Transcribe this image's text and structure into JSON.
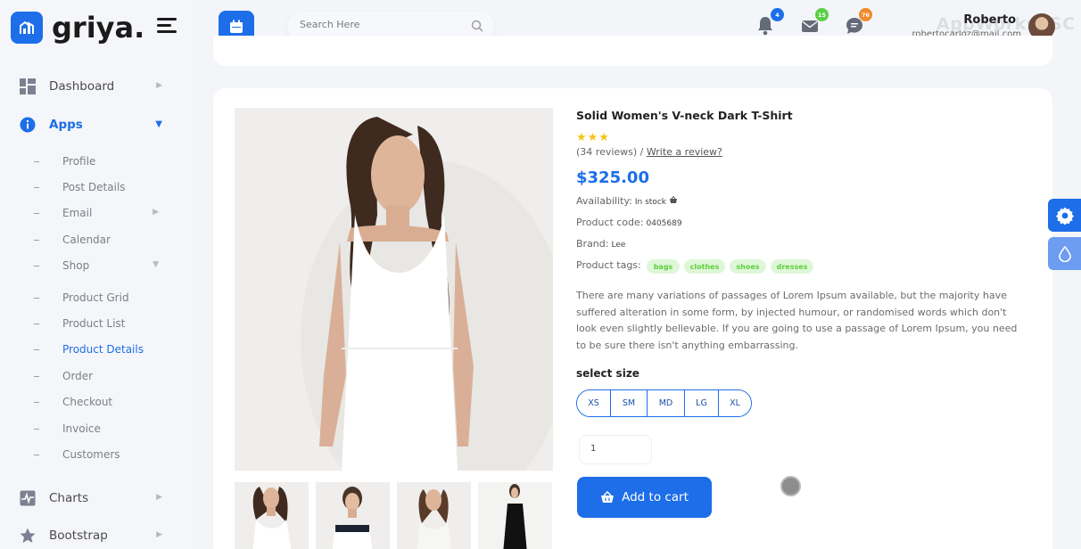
{
  "brand": {
    "name": "griya."
  },
  "sidebar": {
    "items": [
      {
        "label": "Dashboard",
        "icon": "grid-icon"
      },
      {
        "label": "Apps",
        "icon": "info-icon",
        "active": true
      },
      {
        "label": "Charts",
        "icon": "chart-icon"
      },
      {
        "label": "Bootstrap",
        "icon": "star-icon"
      }
    ],
    "apps_sub": [
      {
        "label": "Profile"
      },
      {
        "label": "Post Details"
      },
      {
        "label": "Email"
      },
      {
        "label": "Calendar"
      },
      {
        "label": "Shop"
      }
    ],
    "shop_sub": [
      {
        "label": "Product Grid"
      },
      {
        "label": "Product List"
      },
      {
        "label": "Product Details",
        "current": true
      },
      {
        "label": "Order"
      },
      {
        "label": "Checkout"
      },
      {
        "label": "Invoice"
      },
      {
        "label": "Customers"
      }
    ]
  },
  "header": {
    "search_placeholder": "Search Here",
    "notifications": {
      "count": "4",
      "color": "#1d6ee8"
    },
    "messages": {
      "count": "15",
      "color": "#5ccf45"
    },
    "chats": {
      "count": "76",
      "color": "#f08a2c"
    },
    "user": {
      "name": "Roberto",
      "email": "robertocarloz@mail.com"
    },
    "watermark": "AppWorksPSC"
  },
  "product": {
    "title": "Solid Women's V-neck Dark T-Shirt",
    "stars": "★★★",
    "reviews": "(34 reviews) /",
    "write_review": "Write a review?",
    "price": "$325.00",
    "availability_label": "Availability:",
    "availability_value": "In stock",
    "code_label": "Product code:",
    "code_value": "0405689",
    "brand_label": "Brand:",
    "brand_value": "Lee",
    "tags_label": "Product tags:",
    "tags": [
      "bags",
      "clothes",
      "shoes",
      "dresses"
    ],
    "description": "There are many variations of passages of Lorem Ipsum available, but the majority have suffered alteration in some form, by injected humour, or randomised words which don't look even slightly believable. If you are going to use a passage of Lorem Ipsum, you need to be sure there isn't anything embarrassing.",
    "size_label": "select size",
    "sizes": [
      "XS",
      "SM",
      "MD",
      "LG",
      "XL"
    ],
    "quantity": "1",
    "add_to_cart": "Add to cart"
  },
  "colors": {
    "accent": "#1d6ee8",
    "tag_bg": "#dff7d9",
    "tag_text": "#5fcf3c",
    "stars": "#f4c41a"
  }
}
